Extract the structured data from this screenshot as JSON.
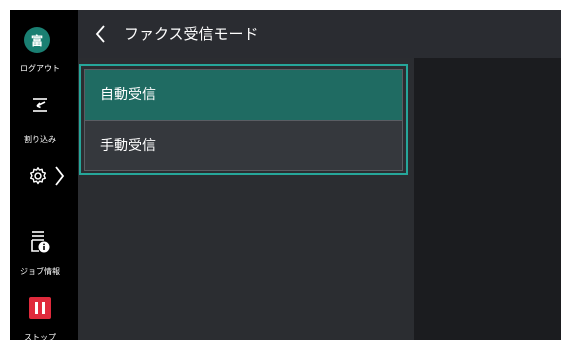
{
  "sidebar": {
    "avatar_char": "富",
    "logout_label": "ログアウト",
    "interrupt_label": "割り込み",
    "job_info_label": "ジョブ情報",
    "stop_label": "ストップ"
  },
  "header": {
    "title": "ファクス受信モード"
  },
  "menu": {
    "items": [
      {
        "label": "自動受信",
        "selected": true
      },
      {
        "label": "手動受信",
        "selected": false
      }
    ]
  },
  "colors": {
    "accent": "#26a69a",
    "selected_bg": "#1f6b62",
    "stop_red": "#e02a3c",
    "avatar_bg": "#1a7f72"
  }
}
